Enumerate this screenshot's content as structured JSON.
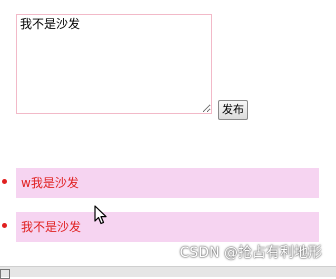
{
  "compose": {
    "textarea_value": "我不是沙发",
    "publish_label": "发布"
  },
  "posts": [
    {
      "text": "w我是沙发"
    },
    {
      "text": "我不是沙发"
    }
  ],
  "watermark": "CSDN @抢占有利地形",
  "colors": {
    "post_background": "#f6d4f1",
    "post_text": "#e02020",
    "textarea_border": "#f2b9c8"
  },
  "icons": {
    "cursor": "mouse-pointer-icon",
    "bullet": "red-dot-bullet"
  }
}
